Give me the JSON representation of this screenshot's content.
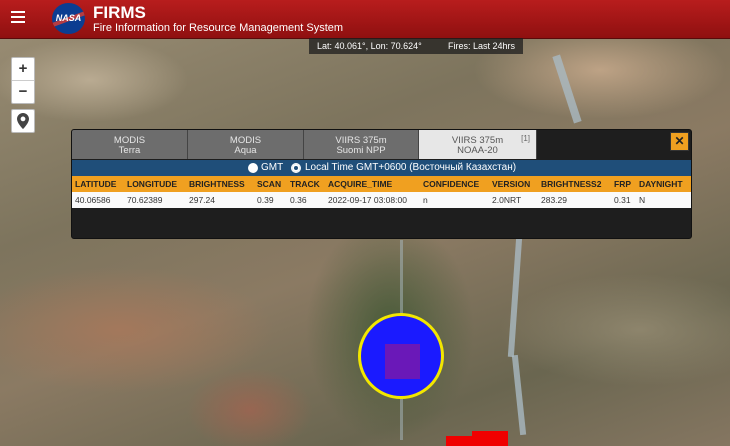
{
  "header": {
    "app_title": "FIRMS",
    "app_subtitle": "Fire Information for Resource Management System",
    "logo_text": "NASA",
    "background_color": "#a51616"
  },
  "info_bar": {
    "coordinates": "Lat: 40.061°, Lon: 70.624°",
    "fires_range": "Fires: Last 24hrs"
  },
  "map_controls": {
    "zoom_in": "+",
    "zoom_out": "−",
    "locate_icon": "map-pin-icon"
  },
  "panel": {
    "tabs": [
      {
        "line1": "MODIS",
        "line2": "Terra",
        "active": false
      },
      {
        "line1": "MODIS",
        "line2": "Aqua",
        "active": false
      },
      {
        "line1": "VIIRS 375m",
        "line2": "Suomi NPP",
        "active": false
      },
      {
        "line1": "VIIRS 375m",
        "line2": "NOAA-20",
        "active": true,
        "count": "[1]"
      }
    ],
    "close_label": "✕",
    "timezone": {
      "gmt_label": "GMT",
      "local_label": "Local Time GMT+0600 (Восточный Казахстан)",
      "selected": "local"
    },
    "columns": [
      "LATITUDE",
      "LONGITUDE",
      "BRIGHTNESS",
      "SCAN",
      "TRACK",
      "ACQUIRE_TIME",
      "CONFIDENCE",
      "VERSION",
      "BRIGHTNESS2",
      "FRP",
      "DAYNIGHT"
    ],
    "rows": [
      [
        "40.06586",
        "70.62389",
        "297.24",
        "0.39",
        "0.36",
        "2022-09-17 03:08:00",
        "n",
        "2.0NRT",
        "283.29",
        "0.31",
        "N"
      ]
    ],
    "header_color": "#f0a020",
    "timezone_bar_color": "#1f4e79"
  },
  "fire_marker": {
    "circle_color": "#1a1aff",
    "ring_color": "#f2e600",
    "square_color": "#6a18b8"
  }
}
